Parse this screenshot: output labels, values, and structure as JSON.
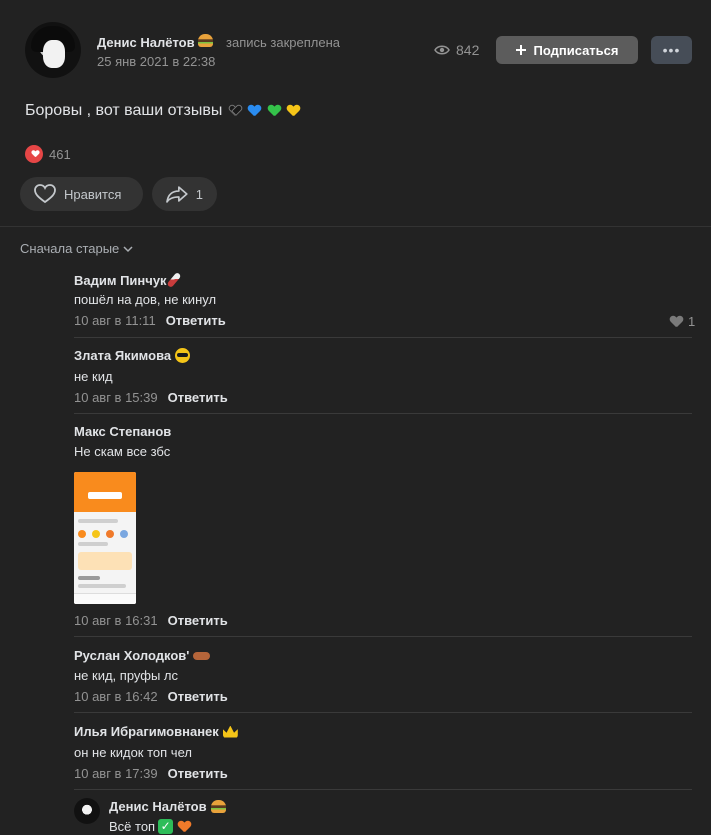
{
  "post": {
    "author": "Денис Налётов",
    "pinned": "запись закреплена",
    "date": "25 янв 2021 в 22:38",
    "views": "842",
    "subscribe_label": "Подписаться",
    "more_label": "•••",
    "text": "Боровы , вот ваши отзывы",
    "likes_count": "461",
    "like_label": "Нравится",
    "share_count": "1"
  },
  "comments_header": {
    "sort_label": "Сначала старые"
  },
  "comments": [
    {
      "name": "Вадим Пинчук",
      "text": "пошёл на дов, не кинул",
      "date": "10 авг в 11:11",
      "reply": "Ответить",
      "likes": "1"
    },
    {
      "name": "Злата Якимова",
      "text": "не кид",
      "date": "10 авг в 15:39",
      "reply": "Ответить"
    },
    {
      "name": "Макс Степанов",
      "text": "Не скам все збс",
      "date": "10 авг в 16:31",
      "reply": "Ответить"
    },
    {
      "name": "Руслан Холодков'",
      "text": "не кид, пруфы лс",
      "date": "10 авг в 16:42",
      "reply": "Ответить"
    },
    {
      "name": "Илья Ибрагимовнанек",
      "text": "он не кидок топ чел",
      "date": "10 авг в 17:39",
      "reply": "Ответить"
    }
  ],
  "reply_comment": {
    "name": "Денис Налётов",
    "text": "Всё топ"
  },
  "colors": {
    "background": "#222222",
    "accent_like": "#e64646",
    "button_bg": "#5c5c5c"
  }
}
